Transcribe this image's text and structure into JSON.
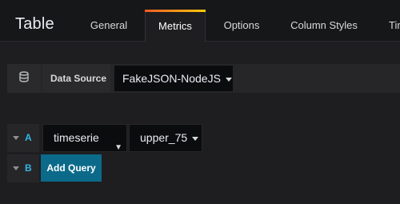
{
  "panel": {
    "title": "Table"
  },
  "tabs": [
    {
      "label": "General",
      "active": false
    },
    {
      "label": "Metrics",
      "active": true
    },
    {
      "label": "Options",
      "active": false
    },
    {
      "label": "Column Styles",
      "active": false
    },
    {
      "label": "Tim",
      "active": false
    }
  ],
  "datasource": {
    "icon": "database-icon",
    "label": "Data Source",
    "selected": "FakeJSON-NodeJS"
  },
  "queries": [
    {
      "ref": "A",
      "type": "timeserie",
      "target": "upper_75"
    },
    {
      "ref": "B"
    }
  ],
  "add_query_label": "Add Query",
  "colors": {
    "accent": "#33b5e5",
    "button": "#0b6a8a",
    "tab_gradient_start": "#f05a28",
    "tab_gradient_end": "#fbca0a",
    "background": "#1e1d20"
  }
}
